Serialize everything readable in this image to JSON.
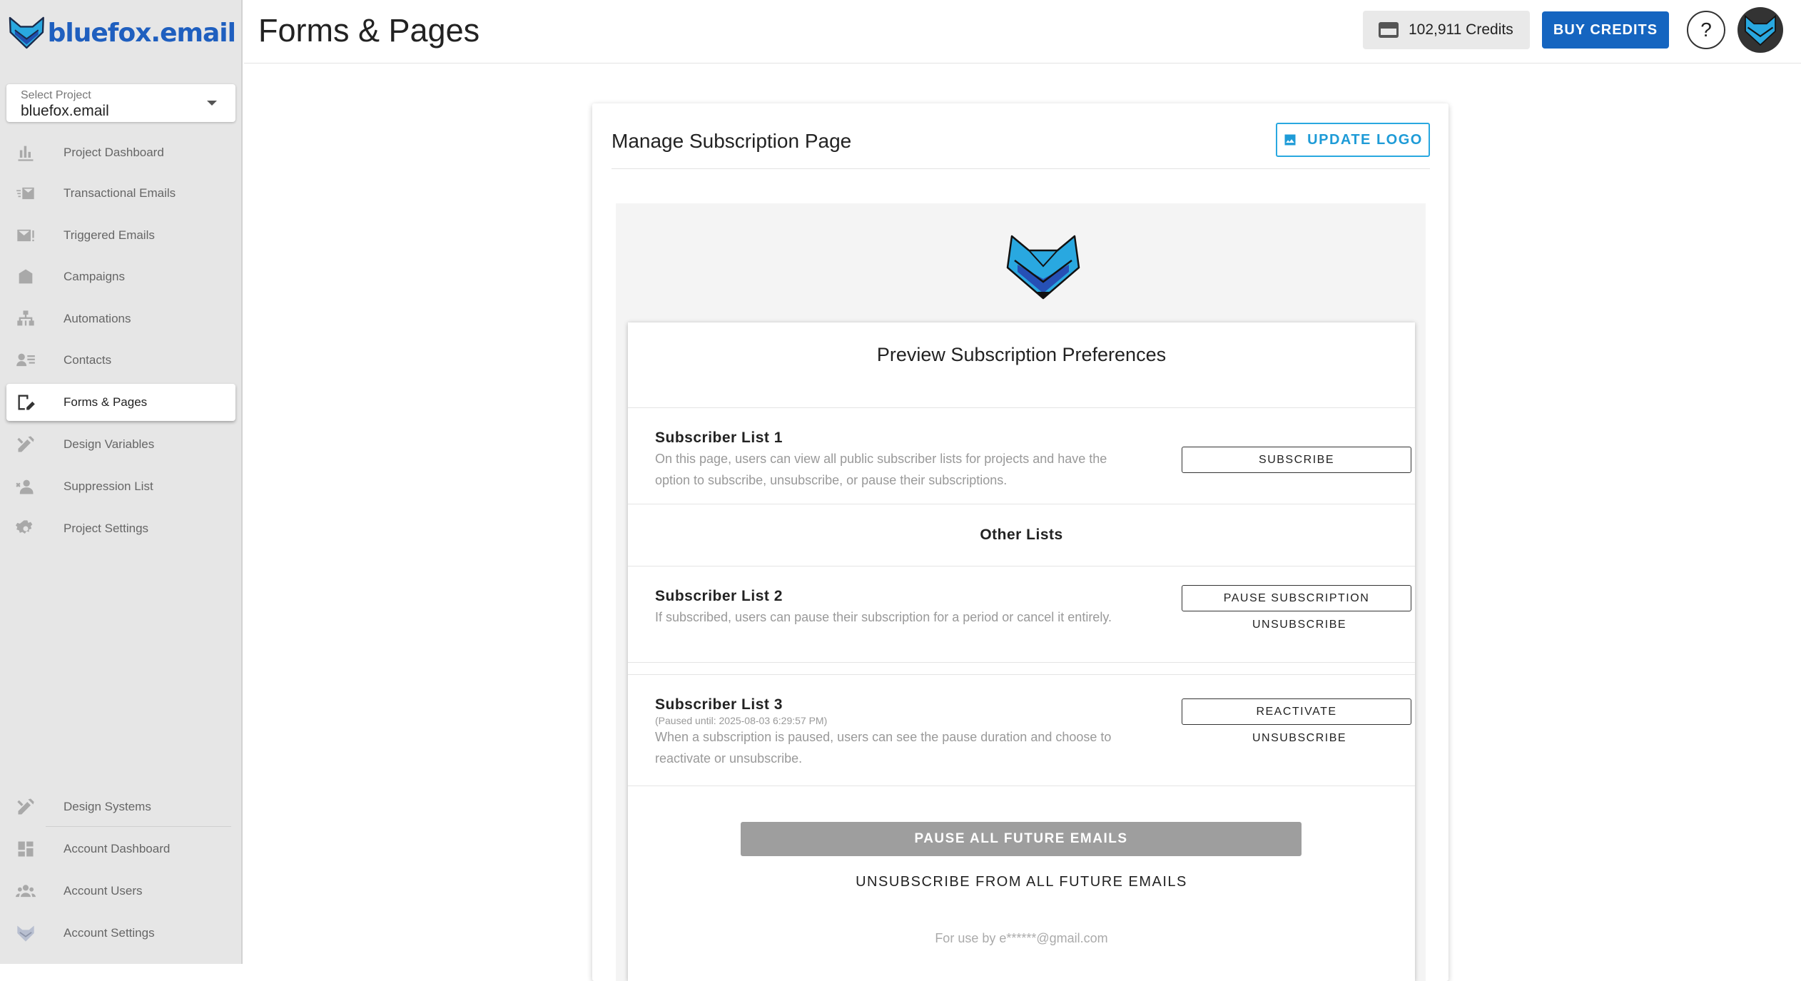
{
  "brand": {
    "name": "bluefox.email"
  },
  "project_select": {
    "label": "Select Project",
    "value": "bluefox.email"
  },
  "nav": {
    "items": [
      {
        "label": "Project Dashboard",
        "icon": "chart-icon"
      },
      {
        "label": "Transactional Emails",
        "icon": "fast-mail-icon"
      },
      {
        "label": "Triggered Emails",
        "icon": "mail-alert-icon"
      },
      {
        "label": "Campaigns",
        "icon": "campaign-icon"
      },
      {
        "label": "Automations",
        "icon": "sitemap-icon"
      },
      {
        "label": "Contacts",
        "icon": "contacts-icon"
      },
      {
        "label": "Forms & Pages",
        "icon": "form-edit-icon",
        "active": true
      },
      {
        "label": "Design Variables",
        "icon": "design-tools-icon"
      },
      {
        "label": "Suppression List",
        "icon": "user-block-icon"
      },
      {
        "label": "Project Settings",
        "icon": "gear-icon"
      }
    ],
    "bottom_items": [
      {
        "label": "Design Systems",
        "icon": "design-tools-icon"
      },
      {
        "label": "Account Dashboard",
        "icon": "dashboard-icon"
      },
      {
        "label": "Account Users",
        "icon": "users-icon"
      },
      {
        "label": "Account Settings",
        "icon": "fox-icon"
      }
    ]
  },
  "header": {
    "title": "Forms & Pages",
    "credits": "102,911 Credits",
    "buy_credits": "BUY CREDITS",
    "help": "?"
  },
  "card": {
    "title": "Manage Subscription Page",
    "update_logo": "UPDATE LOGO"
  },
  "preview": {
    "title": "Preview Subscription Preferences",
    "primary_list": {
      "name": "Subscriber List 1",
      "description": "On this page, users can view all public subscriber lists for projects and have the option to subscribe, unsubscribe, or pause their subscriptions.",
      "action": "SUBSCRIBE"
    },
    "other_lists_heading": "Other Lists",
    "list2": {
      "name": "Subscriber List 2",
      "description": "If subscribed, users can pause their subscription for a period or cancel it entirely.",
      "action": "PAUSE SUBSCRIPTION",
      "secondary": "UNSUBSCRIBE"
    },
    "list3": {
      "name": "Subscriber List 3",
      "paused_until": "(Paused until: 2025-08-03 6:29:57 PM)",
      "description": "When a subscription is paused, users can see the pause duration and choose to reactivate or unsubscribe.",
      "action": "REACTIVATE",
      "secondary": "UNSUBSCRIBE"
    },
    "pause_all": "PAUSE ALL FUTURE EMAILS",
    "unsubscribe_all": "UNSUBSCRIBE FROM ALL FUTURE EMAILS",
    "for_use": "For use by e******@gmail.com"
  },
  "colors": {
    "accent": "#1565c0",
    "update_logo": "#29a8e0",
    "sidebar_bg": "#e6e6e6",
    "fox_blue": "#29a8e0",
    "fox_dark": "#1f3f8f"
  }
}
